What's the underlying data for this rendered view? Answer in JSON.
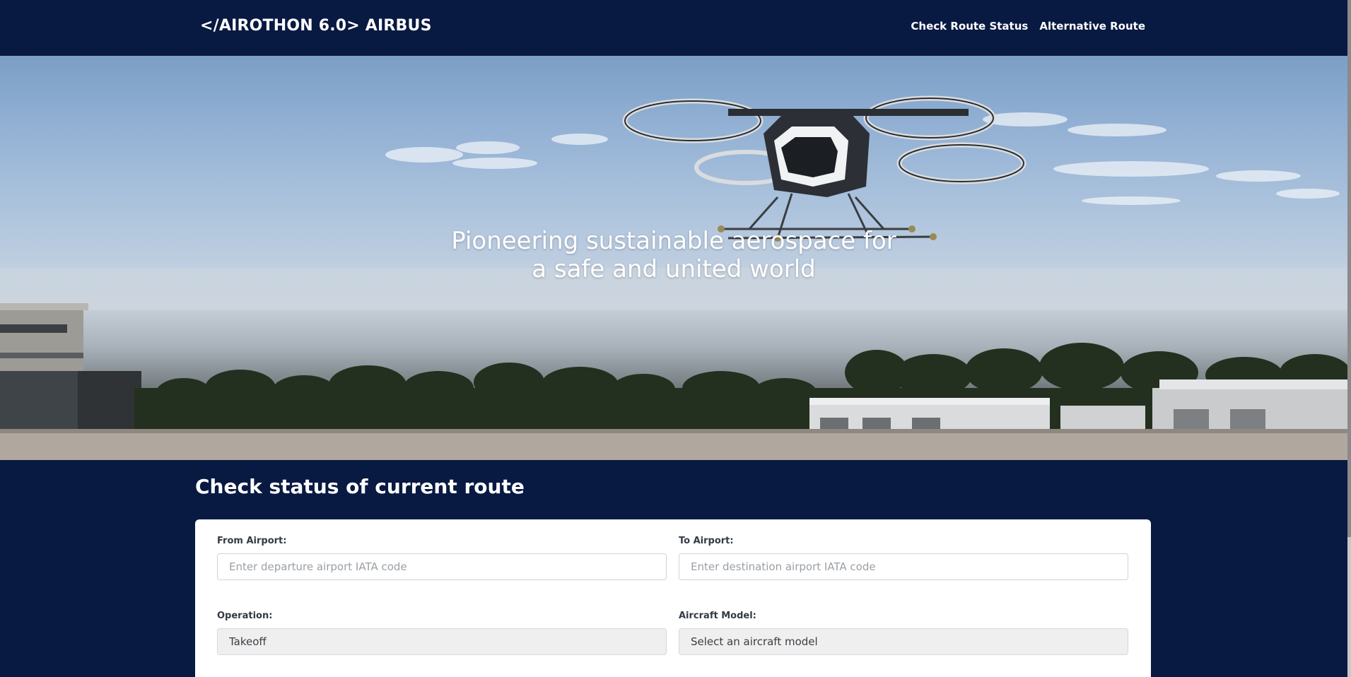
{
  "navbar": {
    "brand": "</AIROTHON 6.0> AIRBUS",
    "links": [
      {
        "label": "Check Route Status"
      },
      {
        "label": "Alternative Route"
      }
    ]
  },
  "hero": {
    "line1": "Pioneering sustainable aerospace for",
    "line2": "a safe and united world"
  },
  "route_check": {
    "title": "Check status of current route",
    "from_airport": {
      "label": "From Airport:",
      "placeholder": "Enter departure airport IATA code",
      "value": ""
    },
    "to_airport": {
      "label": "To Airport:",
      "placeholder": "Enter destination airport IATA code",
      "value": ""
    },
    "operation": {
      "label": "Operation:",
      "selected": "Takeoff"
    },
    "aircraft_model": {
      "label": "Aircraft Model:",
      "selected": "Select an aircraft model"
    }
  },
  "colors": {
    "navy": "#081942",
    "white": "#ffffff"
  }
}
